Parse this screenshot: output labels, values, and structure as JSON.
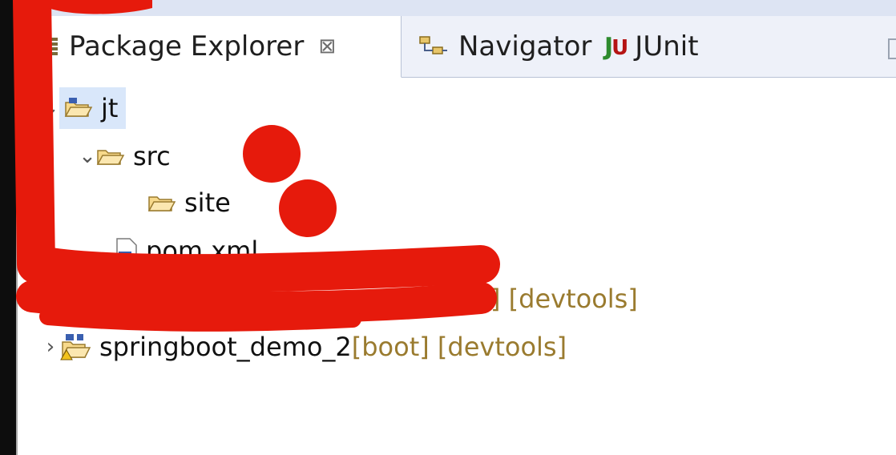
{
  "tabs": [
    {
      "label": "Package Explorer",
      "close": "⊠",
      "active": true
    },
    {
      "label": "Navigator"
    },
    {
      "label": "JUnit"
    }
  ],
  "junit_icon": {
    "j": "J",
    "u": "U"
  },
  "tree": {
    "jt": {
      "label": "jt",
      "twisty": "⌄"
    },
    "src": {
      "label": "src",
      "twisty": "⌄"
    },
    "site": {
      "label": "site"
    },
    "pom": {
      "label": "pom.xml"
    },
    "hidden_project": {
      "label_visible": "] [devtools]"
    },
    "springboot_demo_2": {
      "label": "springboot_demo_2",
      "decorations": " [boot] [devtools]",
      "twisty": "›"
    }
  },
  "colors": {
    "selection": "#d9e7fa",
    "annotation_red": "#e61a0c",
    "decoration": "#9a7b2f"
  }
}
